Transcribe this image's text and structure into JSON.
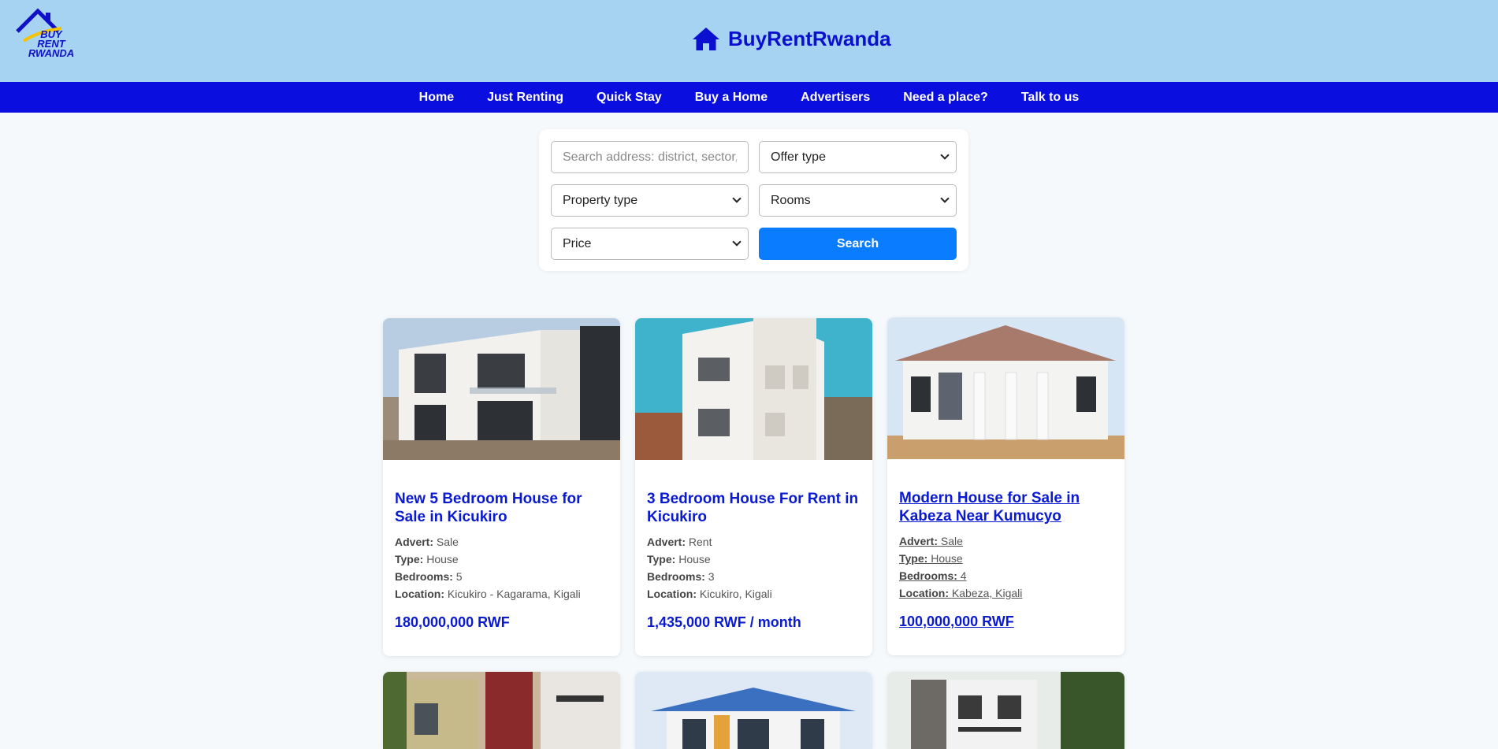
{
  "header": {
    "logo_text": [
      "BUY",
      "RENT",
      "RWANDA"
    ],
    "brand_name": "BuyRentRwanda",
    "brand_color": "#0a0fd0",
    "background": "#a6d3f2"
  },
  "nav": {
    "background": "#0a0fe0",
    "items": [
      "Home",
      "Just Renting",
      "Quick Stay",
      "Buy a Home",
      "Advertisers",
      "Need a place?",
      "Talk to us"
    ]
  },
  "search": {
    "address_placeholder": "Search address: district, sector, c",
    "offer_type": "Offer type",
    "property_type": "Property type",
    "rooms": "Rooms",
    "price": "Price",
    "button_label": "Search",
    "button_color": "#0a7cff"
  },
  "labels": {
    "advert": "Advert:",
    "type": "Type:",
    "bedrooms": "Bedrooms:",
    "location": "Location:"
  },
  "listings": [
    {
      "title": "New 5 Bedroom House for Sale in Kicukiro",
      "advert": "Sale",
      "type": "House",
      "bedrooms": "5",
      "location": "Kicukiro - Kagarama, Kigali",
      "price": "180,000,000 RWF"
    },
    {
      "title": "3 Bedroom House For Rent in Kicukiro",
      "advert": "Rent",
      "type": "House",
      "bedrooms": "3",
      "location": "Kicukiro, Kigali",
      "price": "1,435,000 RWF / month"
    },
    {
      "title": "Modern House for Sale in Kabeza Near Kumucyo",
      "advert": "Sale",
      "type": "House",
      "bedrooms": "4",
      "location": "Kabeza, Kigali",
      "price": "100,000,000 RWF"
    }
  ],
  "icons": {
    "brand": "house-icon",
    "select": "chevron-down-icon"
  }
}
